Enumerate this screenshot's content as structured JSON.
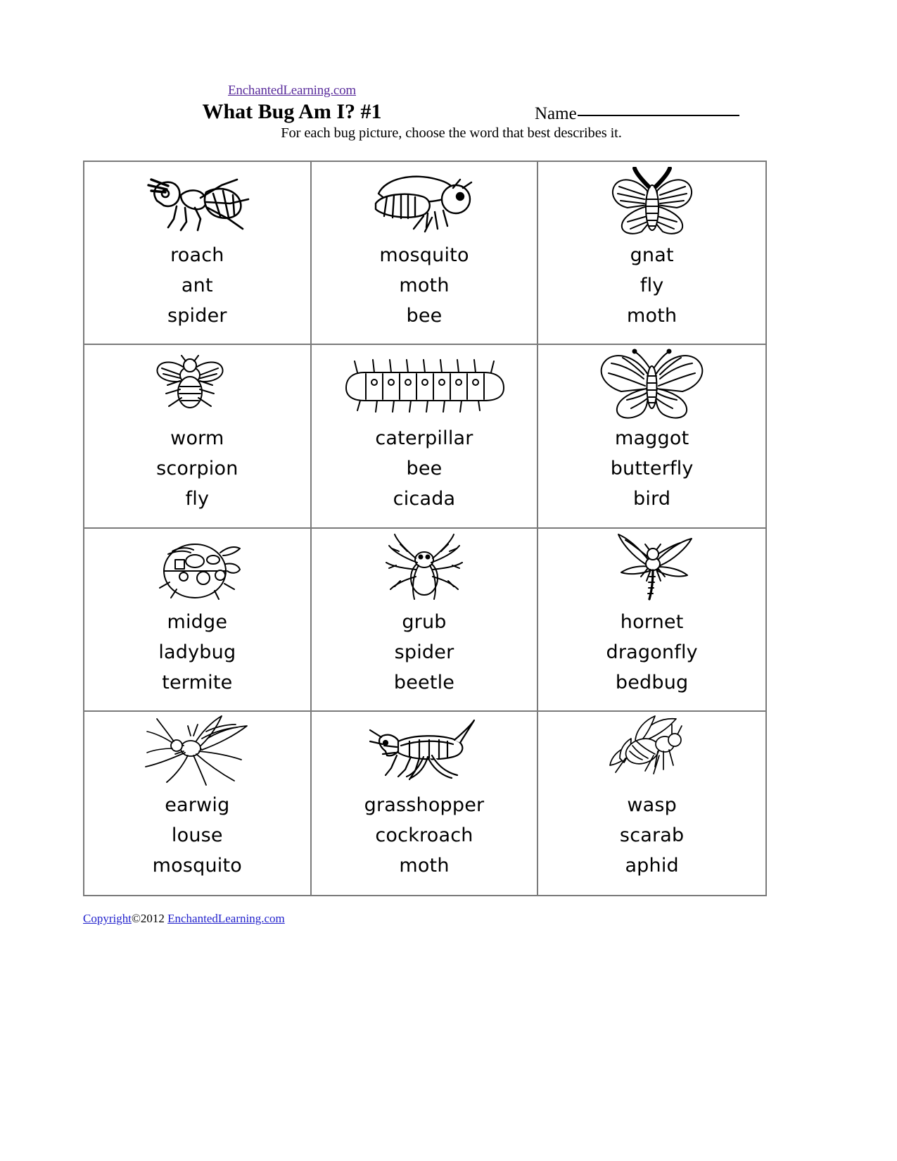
{
  "header": {
    "site_link": "EnchantedLearning.com",
    "title": "What Bug Am I? #1",
    "instructions": "For each bug picture, choose the word that best describes it.",
    "name_label": "Name"
  },
  "grid": {
    "cells": [
      {
        "bug": "ant-illustration",
        "choices": [
          "roach",
          "ant",
          "spider"
        ]
      },
      {
        "bug": "bee-illustration",
        "choices": [
          "mosquito",
          "moth",
          "bee"
        ]
      },
      {
        "bug": "moth-illustration",
        "choices": [
          "gnat",
          "fly",
          "moth"
        ]
      },
      {
        "bug": "fly-illustration",
        "choices": [
          "worm",
          "scorpion",
          "fly"
        ]
      },
      {
        "bug": "caterpillar-illustration",
        "choices": [
          "caterpillar",
          "bee",
          "cicada"
        ]
      },
      {
        "bug": "butterfly-illustration",
        "choices": [
          "maggot",
          "butterfly",
          "bird"
        ]
      },
      {
        "bug": "ladybug-illustration",
        "choices": [
          "midge",
          "ladybug",
          "termite"
        ]
      },
      {
        "bug": "spider-illustration",
        "choices": [
          "grub",
          "spider",
          "beetle"
        ]
      },
      {
        "bug": "dragonfly-illustration",
        "choices": [
          "hornet",
          "dragonfly",
          "bedbug"
        ]
      },
      {
        "bug": "mosquito-illustration",
        "choices": [
          "earwig",
          "louse",
          "mosquito"
        ]
      },
      {
        "bug": "grasshopper-illustration",
        "choices": [
          "grasshopper",
          "cockroach",
          "moth"
        ]
      },
      {
        "bug": "wasp-illustration",
        "choices": [
          "wasp",
          "scarab",
          "aphid"
        ]
      }
    ]
  },
  "footer": {
    "copyright_link": "Copyright",
    "copyright_text": "©2012 ",
    "site_link": "EnchantedLearning.com"
  },
  "colors": {
    "link_purple": "#5a2d9c",
    "link_blue": "#2222cc",
    "grid_border": "#7a7a7a",
    "text": "#000000"
  }
}
